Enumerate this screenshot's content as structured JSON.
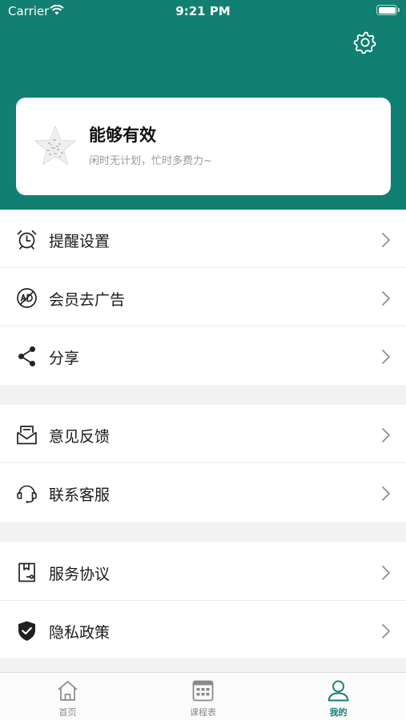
{
  "status_bar": {
    "carrier": "Carrier",
    "time": "9:21 PM"
  },
  "header": {
    "background_color": "#117f72",
    "settings_icon": "gear-icon"
  },
  "profile": {
    "name": "能够有效",
    "motto": "闲时无计划，忙时多费力~",
    "avatar_icon": "star-avatar-icon"
  },
  "menu_groups": [
    {
      "items": [
        {
          "label": "提醒设置",
          "icon": "alarm-clock-icon"
        },
        {
          "label": "会员去广告",
          "icon": "ad-icon"
        },
        {
          "label": "分享",
          "icon": "share-icon"
        }
      ]
    },
    {
      "items": [
        {
          "label": "意见反馈",
          "icon": "envelope-icon"
        },
        {
          "label": "联系客服",
          "icon": "headset-icon"
        }
      ]
    },
    {
      "items": [
        {
          "label": "服务协议",
          "icon": "document-icon"
        },
        {
          "label": "隐私政策",
          "icon": "shield-check-icon"
        }
      ]
    }
  ],
  "tabbar": {
    "active": "我的",
    "accent_color": "#117f72",
    "tabs": [
      {
        "label": "首页",
        "icon": "home-icon"
      },
      {
        "label": "课程表",
        "icon": "calendar-grid-icon"
      },
      {
        "label": "我的",
        "icon": "person-icon"
      }
    ]
  }
}
